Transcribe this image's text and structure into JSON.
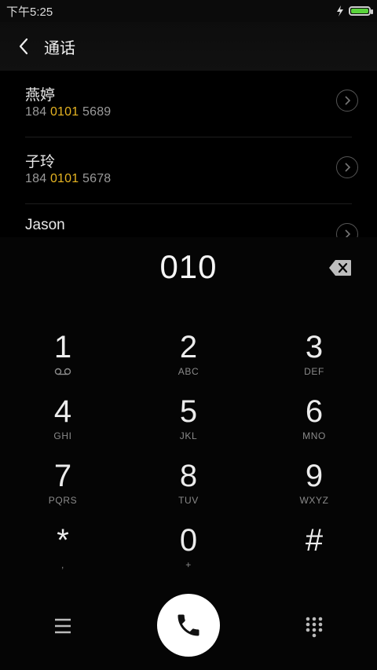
{
  "status": {
    "time": "下午5:25",
    "battery_level": 1.0,
    "battery_color": "#59d23b"
  },
  "header": {
    "title": "通话"
  },
  "contacts": [
    {
      "name": "燕婷",
      "number_prefix": "184 ",
      "number_match": "0101",
      "number_suffix": " 5689"
    },
    {
      "name": "子玲",
      "number_prefix": "184 ",
      "number_match": "0101",
      "number_suffix": " 5678"
    },
    {
      "name": "Jason"
    }
  ],
  "dialer": {
    "input": "010",
    "keys": [
      {
        "digit": "1",
        "letters": ""
      },
      {
        "digit": "2",
        "letters": "ABC"
      },
      {
        "digit": "3",
        "letters": "DEF"
      },
      {
        "digit": "4",
        "letters": "GHI"
      },
      {
        "digit": "5",
        "letters": "JKL"
      },
      {
        "digit": "6",
        "letters": "MNO"
      },
      {
        "digit": "7",
        "letters": "PQRS"
      },
      {
        "digit": "8",
        "letters": "TUV"
      },
      {
        "digit": "9",
        "letters": "WXYZ"
      },
      {
        "digit": "*",
        "letters": ","
      },
      {
        "digit": "0",
        "letters": "+"
      },
      {
        "digit": "#",
        "letters": ""
      }
    ]
  },
  "colors": {
    "highlight": "#e6b422",
    "background": "#000000"
  },
  "icons": {
    "back": "chevron-left-icon",
    "contact_detail": "chevron-right-circle-icon",
    "backspace": "backspace-icon",
    "voicemail": "voicemail-icon",
    "menu": "menu-icon",
    "call": "phone-icon",
    "dialpad": "dialpad-icon"
  }
}
